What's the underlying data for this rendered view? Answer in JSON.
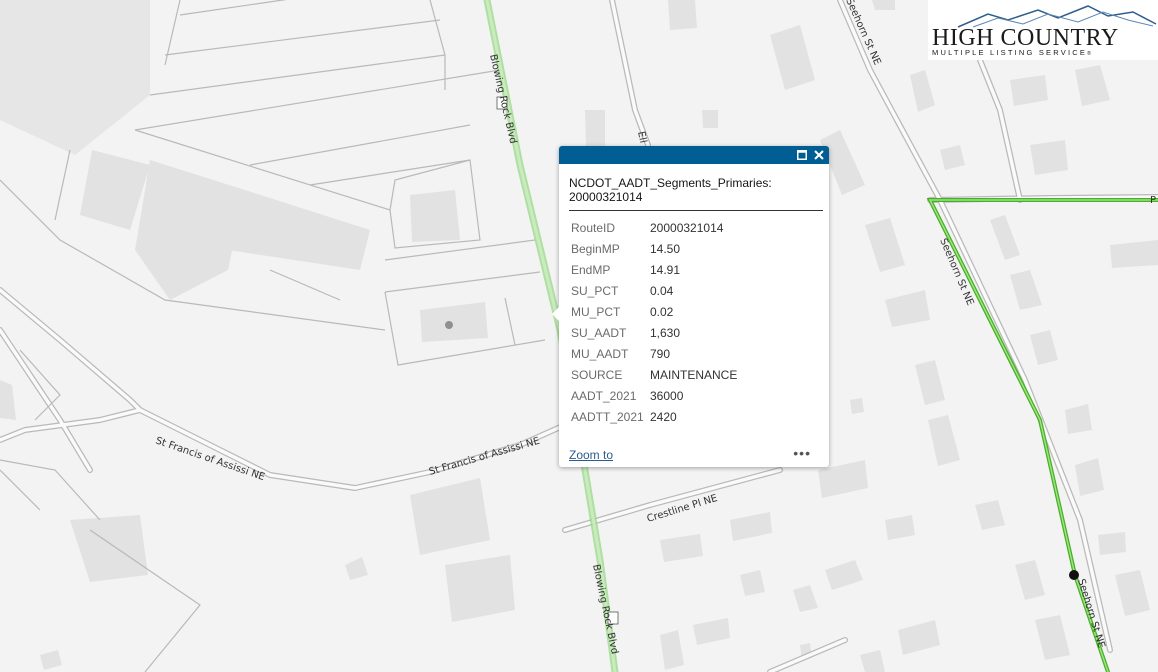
{
  "map": {
    "roads": {
      "blowing_rock_top": "Blowing Rock Blvd",
      "blowing_rock_bottom": "Blowing Rock Blvd",
      "st_francis_left": "St Francis of Assissi NE",
      "st_francis_right": "St Francis of Assissi NE",
      "crestline": "Crestline Pl NE",
      "seehorn_top": "Seehorn St NE",
      "seehorn_mid": "Seehorn St NE",
      "seehorn_bottom": "Seehorn St NE",
      "ell_fragment": "Ell",
      "p_fragment": "P"
    },
    "colors": {
      "background": "#f3f3f3",
      "building": "#e3e3e3",
      "road_casing": "#b9b9b9",
      "road_fill": "#fafafa",
      "highlight": "#45b21f",
      "popup_header": "#005e95"
    }
  },
  "popup": {
    "title": "NCDOT_AADT_Segments_Primaries: 20000321014",
    "fields": [
      {
        "name": "RouteID",
        "value": "20000321014"
      },
      {
        "name": "BeginMP",
        "value": "14.50"
      },
      {
        "name": "EndMP",
        "value": "14.91"
      },
      {
        "name": "SU_PCT",
        "value": "0.04"
      },
      {
        "name": "MU_PCT",
        "value": "0.02"
      },
      {
        "name": "SU_AADT",
        "value": "1,630"
      },
      {
        "name": "MU_AADT",
        "value": "790"
      },
      {
        "name": "SOURCE",
        "value": "MAINTENANCE"
      },
      {
        "name": "AADT_2021",
        "value": "36000"
      },
      {
        "name": "AADTT_2021",
        "value": "2420"
      }
    ],
    "zoom_link": "Zoom to",
    "more_icon": "•••",
    "icons": {
      "maximize": "maximize-icon",
      "close": "close-icon"
    }
  },
  "logo": {
    "main": "HIGH COUNTRY",
    "sub": "MULTIPLE LISTING SERVICE",
    "mark": "®"
  }
}
